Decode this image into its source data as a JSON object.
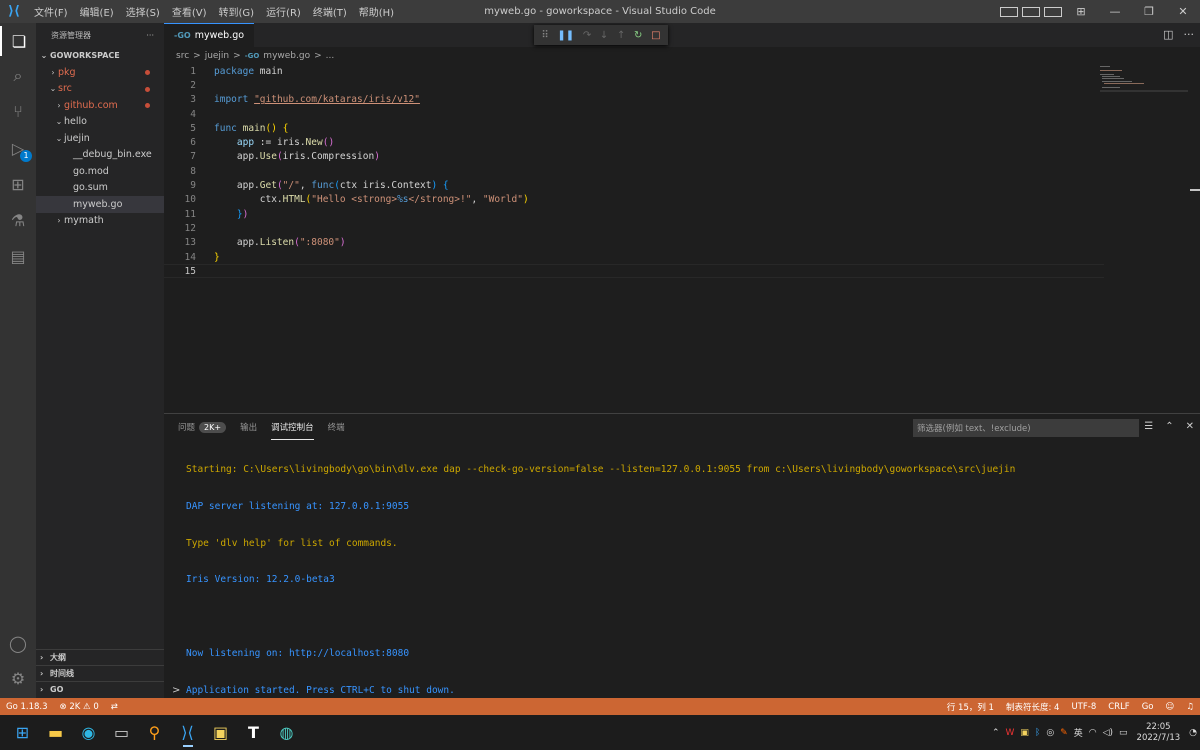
{
  "window": {
    "title": "myweb.go - goworkspace - Visual Studio Code",
    "menu": [
      "文件(F)",
      "编辑(E)",
      "选择(S)",
      "查看(V)",
      "转到(G)",
      "运行(R)",
      "终端(T)",
      "帮助(H)"
    ]
  },
  "activity": {
    "debug_badge": "1"
  },
  "sidebar": {
    "header": "资源管理器",
    "more": "···",
    "root": "GOWORKSPACE",
    "items": [
      {
        "label": "pkg",
        "chev": "›"
      },
      {
        "label": "src",
        "chev": "⌄"
      },
      {
        "label": "github.com",
        "chev": "›"
      },
      {
        "label": "hello",
        "chev": "⌄"
      },
      {
        "label": "juejin",
        "chev": "⌄"
      },
      {
        "label": "__debug_bin.exe",
        "chev": ""
      },
      {
        "label": "go.mod",
        "chev": ""
      },
      {
        "label": "go.sum",
        "chev": ""
      },
      {
        "label": "myweb.go",
        "chev": ""
      },
      {
        "label": "mymath",
        "chev": "›"
      }
    ],
    "outline": "大纲",
    "timeline": "时间线",
    "go": "GO"
  },
  "editor": {
    "tab": "myweb.go",
    "tab_icon": "-GO",
    "breadcrumb": [
      "src",
      ">",
      "juejin",
      ">",
      "myweb.go",
      ">",
      "..."
    ],
    "line_numbers": [
      "1",
      "2",
      "3",
      "4",
      "5",
      "6",
      "7",
      "8",
      "9",
      "10",
      "11",
      "12",
      "13",
      "14",
      "15"
    ]
  },
  "panel": {
    "tabs": [
      "问题",
      "输出",
      "调试控制台",
      "终端"
    ],
    "problems_badge": "2K+",
    "filter_placeholder": "筛选器(例如 text、!exclude)",
    "output": [
      "Starting: C:\\Users\\livingbody\\go\\bin\\dlv.exe dap --check-go-version=false --listen=127.0.0.1:9055 from c:\\Users\\livingbody\\goworkspace\\src\\juejin",
      "DAP server listening at: 127.0.0.1:9055",
      "Type 'dlv help' for list of commands.",
      "Iris Version: 12.2.0-beta3",
      "",
      "Now listening on: http://localhost:8080",
      "Application started. Press CTRL+C to shut down."
    ],
    "prompt": ">"
  },
  "status": {
    "go_version": "Go 1.18.3",
    "problems": "⊗ 2K ⚠ 0",
    "position": "行 15，列 1",
    "indent": "制表符长度: 4",
    "encoding": "UTF-8",
    "eol": "CRLF",
    "language": "Go"
  },
  "taskbar": {
    "ime": "英",
    "time": "22:05",
    "date": "2022/7/13"
  },
  "colors": {
    "statusbar": "#cc6633",
    "accent": "#007acc"
  }
}
